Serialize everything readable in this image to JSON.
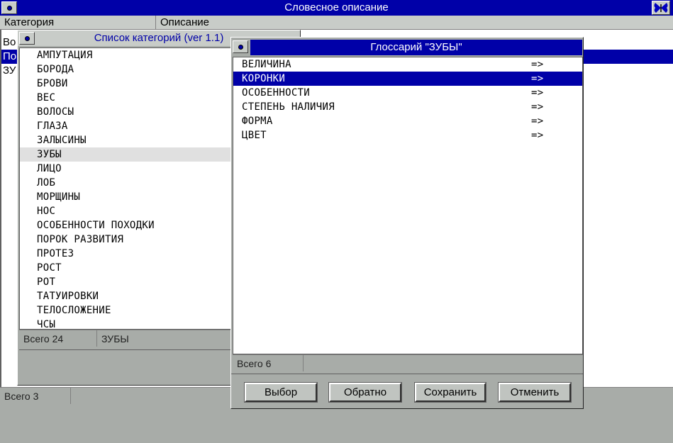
{
  "main": {
    "title": "Словесное описание",
    "columns": [
      "Категория",
      "Описание"
    ],
    "rows": [
      "Во",
      "По",
      "ЗУ"
    ],
    "status_total": "Всего 3"
  },
  "categories": {
    "title": "Список категорий (ver 1.1)",
    "items": [
      "АМПУТАЦИЯ",
      "БОРОДА",
      "БРОВИ",
      "ВЕС",
      "ВОЛОСЫ",
      "ГЛАЗА",
      "ЗАЛЫСИНЫ",
      "ЗУБЫ",
      "ЛИЦО",
      "ЛОБ",
      "МОРЩИНЫ",
      "НОС",
      "ОСОБЕННОСТИ ПОХОДКИ",
      "ПОРОК РАЗВИТИЯ",
      "ПРОТЕЗ",
      "РОСТ",
      "РОТ",
      "ТАТУИРОВКИ",
      "ТЕЛОСЛОЖЕНИЕ",
      "ЧСЫ"
    ],
    "current": "ЗУБЫ",
    "status_total": "Всего 24",
    "status_current": "ЗУБЫ"
  },
  "glossary": {
    "title": "Глоссарий \"ЗУБЫ\"",
    "items": [
      {
        "label": "ВЕЛИЧИНА",
        "arrow": "=>"
      },
      {
        "label": "КОРОНКИ",
        "arrow": "=>"
      },
      {
        "label": "ОСОБЕННОСТИ",
        "arrow": "=>"
      },
      {
        "label": "СТЕПЕНЬ НАЛИЧИЯ",
        "arrow": "=>"
      },
      {
        "label": "ФОРМА",
        "arrow": "=>"
      },
      {
        "label": "ЦВЕТ",
        "arrow": "=>"
      }
    ],
    "selected": "КОРОНКИ",
    "status_total": "Всего 6",
    "buttons": {
      "select": "Выбор",
      "back": "Обратно",
      "save": "Сохранить",
      "cancel": "Отменить"
    }
  },
  "colors": {
    "title_bar": "#0000a8",
    "selection": "#0000a8",
    "background": "#a8aca8"
  },
  "icons": {
    "system_menu": "system-menu-icon",
    "app": "butterfly-icon"
  }
}
